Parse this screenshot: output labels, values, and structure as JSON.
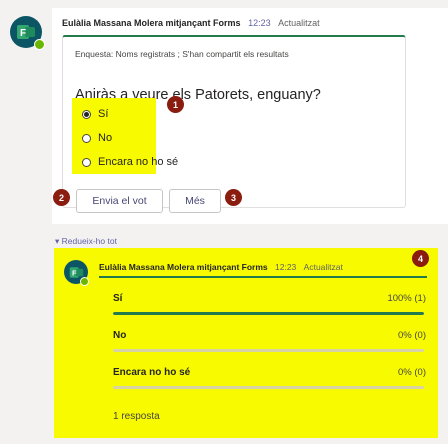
{
  "colors": {
    "accent": "#6264a7",
    "forms_green": "#237b4b",
    "highlight": "#f8fb00",
    "badge": "#8b1c10",
    "presence": "#6bb700"
  },
  "message": {
    "author": "Eulàlia Massana Molera mitjançant Forms",
    "time": "12:23",
    "edited": "Actualitzat",
    "avatar_icon": "forms-app-icon"
  },
  "poll": {
    "subtitle": "Enquesta: Noms registrats ; S'han compartit els resultats",
    "question": "Aniràs a veure els Patorets, enguany?",
    "options": [
      {
        "label": "Sí",
        "checked": true
      },
      {
        "label": "No",
        "checked": false
      },
      {
        "label": "Encara no ho sé",
        "checked": false
      }
    ],
    "submit_label": "Envia el vot",
    "more_label": "Més"
  },
  "badges": [
    "1",
    "2",
    "3",
    "4"
  ],
  "collapse_label": "Redueix-ho tot",
  "reply": {
    "author": "Eulàlia Massana Molera mitjançant Forms",
    "time": "12:23",
    "edited": "Actualitzat",
    "results": [
      {
        "label": "Sí",
        "value": "100% (1)",
        "fraction": 1.0
      },
      {
        "label": "No",
        "value": "0% (0)",
        "fraction": 0.0
      },
      {
        "label": "Encara no ho sé",
        "value": "0% (0)",
        "fraction": 0.0
      }
    ],
    "responses": "1 resposta"
  }
}
